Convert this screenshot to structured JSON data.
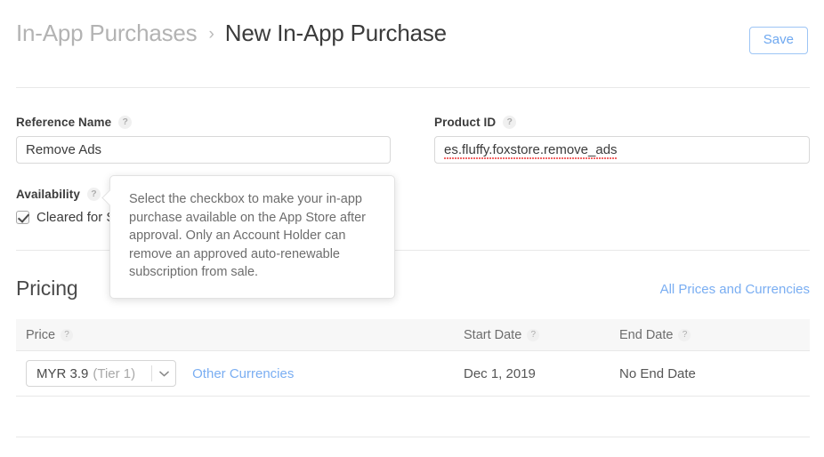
{
  "header": {
    "breadcrumb_parent": "In-App Purchases",
    "breadcrumb_separator": "›",
    "breadcrumb_current": "New In-App Purchase",
    "save_label": "Save"
  },
  "form": {
    "reference_name": {
      "label": "Reference Name",
      "help": "?",
      "value": "Remove Ads",
      "placeholder": "Reference Name"
    },
    "product_id": {
      "label": "Product ID",
      "help": "?",
      "value": "es.fluffy.foxstore.remove_ads",
      "placeholder": "Product ID"
    },
    "availability": {
      "label": "Availability",
      "help": "?",
      "checkbox_label": "Cleared for Sale",
      "checked": true
    }
  },
  "tooltip": {
    "text": "Select the checkbox to make your in-app purchase available on the App Store after approval. Only an Account Holder can remove an approved auto-renewable subscription from sale."
  },
  "pricing": {
    "title": "Pricing",
    "all_prices_link": "All Prices and Currencies",
    "columns": [
      {
        "label": "Price",
        "help": "?"
      },
      {
        "label": "Start Date",
        "help": "?"
      },
      {
        "label": "End Date",
        "help": "?"
      }
    ],
    "row": {
      "price_value": "MYR 3.9",
      "price_tier": "(Tier 1)",
      "chevron": "⌄",
      "other_currencies_link": "Other Currencies",
      "start_date": "Dec 1, 2019",
      "end_date": "No End Date"
    }
  },
  "colors": {
    "link_blue": "#7aaef2",
    "save_border": "#9dc5f5",
    "text_primary": "#3b3b3b",
    "text_secondary": "#6d6d6d",
    "divider": "#e8e8e8",
    "table_header_bg": "#f7f7f7",
    "spellcheck_red": "#f05a5a"
  }
}
